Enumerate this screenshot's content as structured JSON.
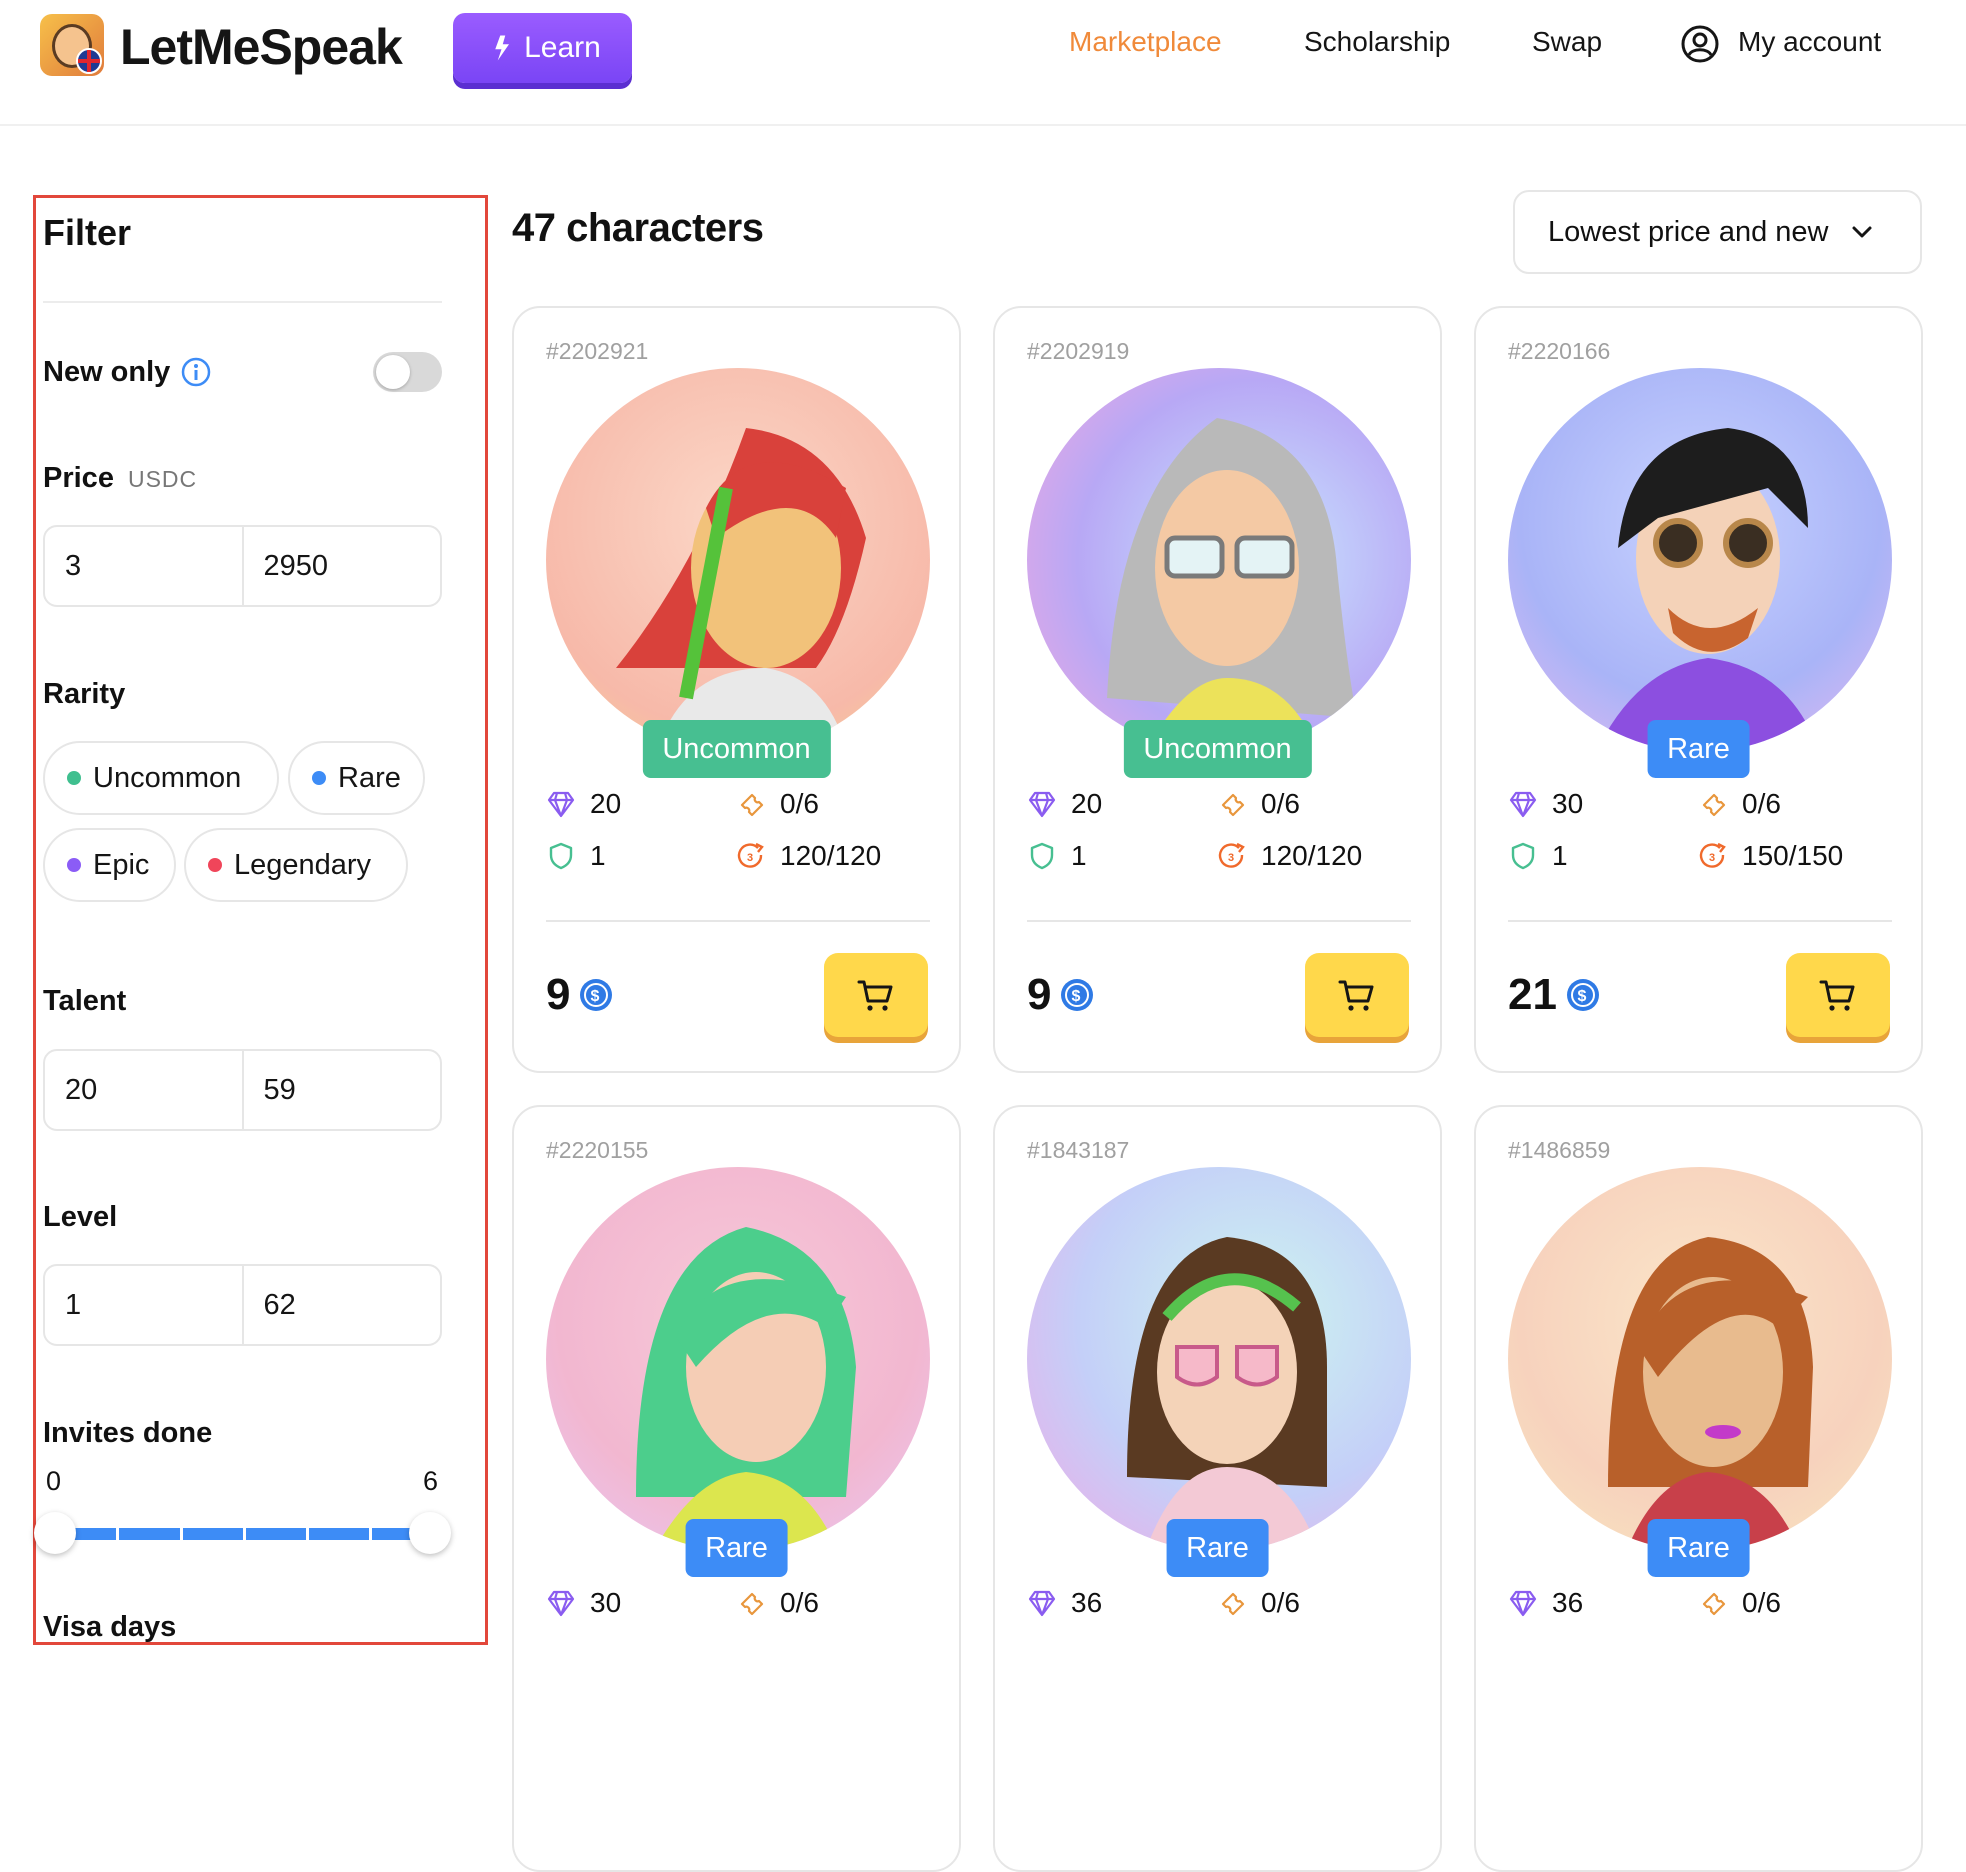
{
  "header": {
    "logo_text": "LetMeSpeak",
    "learn_label": "Learn",
    "nav": [
      "Marketplace",
      "Scholarship",
      "Swap"
    ],
    "account_label": "My account",
    "accent": "#f08a3a"
  },
  "filter": {
    "title": "Filter",
    "new_only_label": "New only",
    "new_only_on": false,
    "price_label": "Price",
    "price_unit": "USDC",
    "price_min": "3",
    "price_max": "2950",
    "rarity_label": "Rarity",
    "rarities": [
      {
        "label": "Uncommon",
        "color": "#3fbf8f"
      },
      {
        "label": "Rare",
        "color": "#3d8cf6"
      },
      {
        "label": "Epic",
        "color": "#8b5cf6"
      },
      {
        "label": "Legendary",
        "color": "#f0455a"
      }
    ],
    "talent_label": "Talent",
    "talent_min": "20",
    "talent_max": "59",
    "level_label": "Level",
    "level_min": "1",
    "level_max": "62",
    "invites_label": "Invites done",
    "invites_min": "0",
    "invites_max": "6",
    "visa_label": "Visa days"
  },
  "main": {
    "count_label": "47 characters",
    "sort_label": "Lowest price and new"
  },
  "cards": [
    {
      "id": "#2202921",
      "rarity": "Uncommon",
      "rarity_color": "#47bf91",
      "talent": "20",
      "invites": "0/6",
      "level": "1",
      "energy": "120/120",
      "price": "9"
    },
    {
      "id": "#2202919",
      "rarity": "Uncommon",
      "rarity_color": "#47bf91",
      "talent": "20",
      "invites": "0/6",
      "level": "1",
      "energy": "120/120",
      "price": "9"
    },
    {
      "id": "#2220166",
      "rarity": "Rare",
      "rarity_color": "#3d8cf6",
      "talent": "30",
      "invites": "0/6",
      "level": "1",
      "energy": "150/150",
      "price": "21"
    },
    {
      "id": "#2220155",
      "rarity": "Rare",
      "rarity_color": "#3d8cf6",
      "talent": "30",
      "invites": "0/6"
    },
    {
      "id": "#1843187",
      "rarity": "Rare",
      "rarity_color": "#3d8cf6",
      "talent": "36",
      "invites": "0/6"
    },
    {
      "id": "#1486859",
      "rarity": "Rare",
      "rarity_color": "#3d8cf6",
      "talent": "36",
      "invites": "0/6"
    }
  ]
}
